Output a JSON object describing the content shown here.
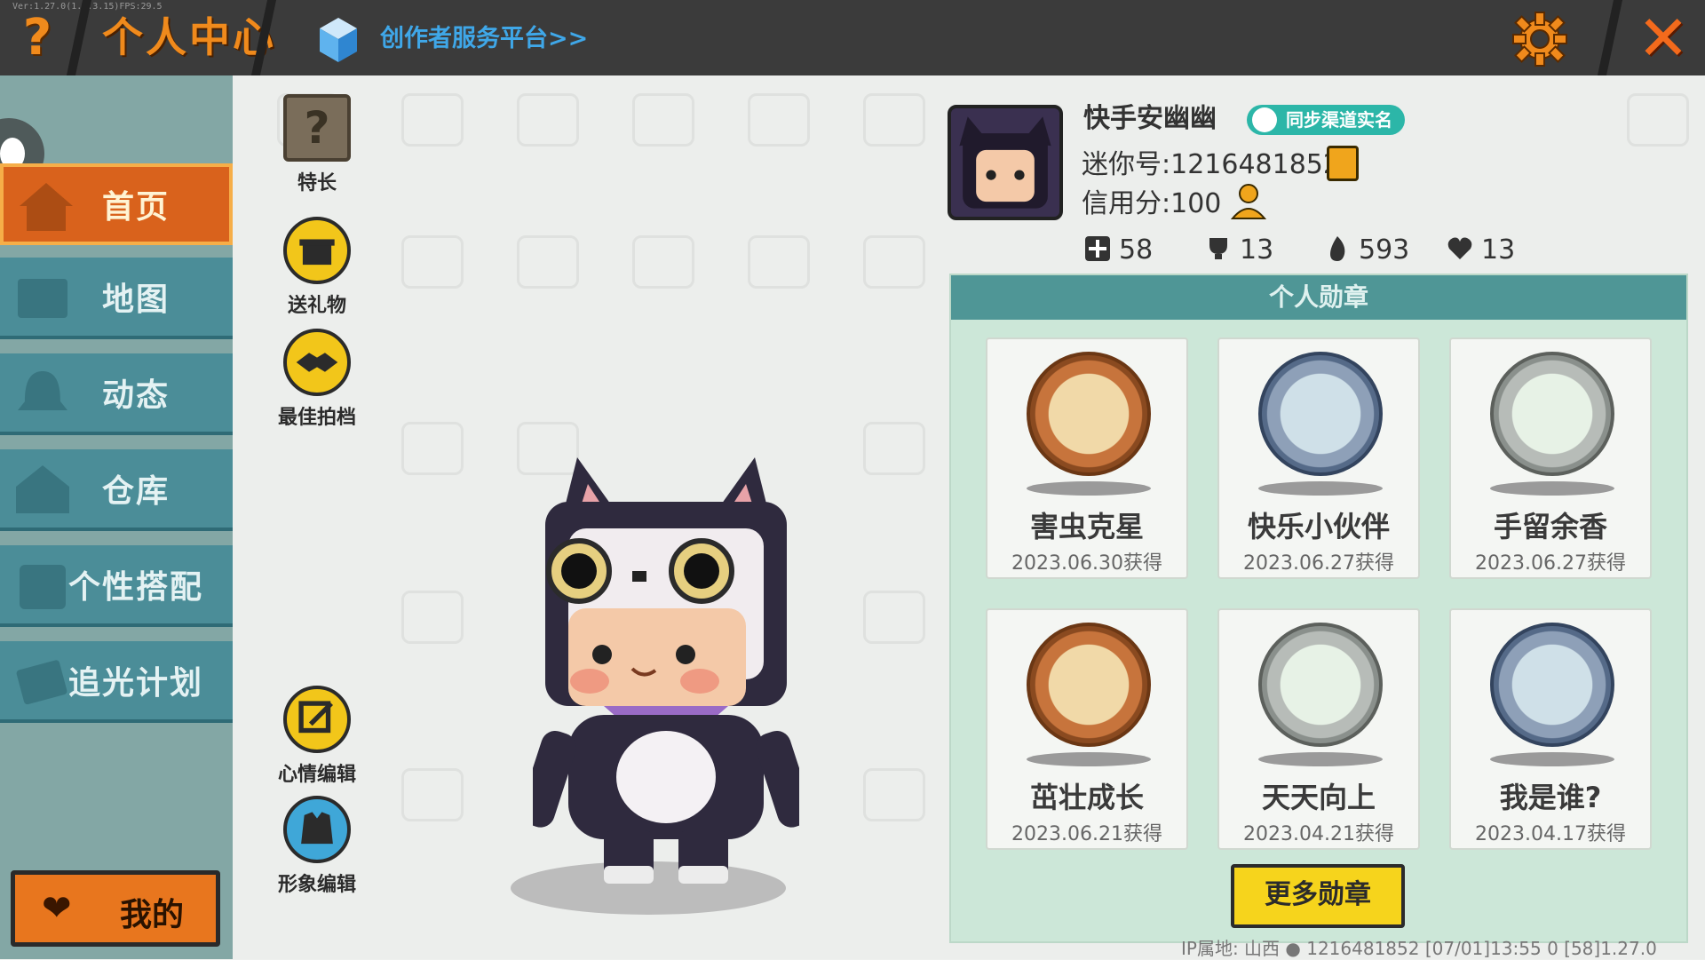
{
  "header": {
    "version_text": "Ver:1.27.0(1.2.3.15)FPS:29.5",
    "help_icon": "?",
    "title": "个人中心",
    "creator_link": "创作者服务平台>>",
    "close_icon": "✕"
  },
  "sidebar": {
    "items": [
      {
        "label": "首页",
        "icon": "home-icon",
        "active": true
      },
      {
        "label": "地图",
        "icon": "map-icon",
        "active": false
      },
      {
        "label": "动态",
        "icon": "bell-icon",
        "active": false
      },
      {
        "label": "仓库",
        "icon": "house-icon",
        "active": false
      },
      {
        "label": "个性搭配",
        "icon": "wardrobe-icon",
        "active": false
      },
      {
        "label": "追光计划",
        "icon": "spotlight-icon",
        "active": false
      }
    ],
    "my_button": "我的"
  },
  "actions": {
    "specialty": "特长",
    "send_gift": "送礼物",
    "best_partner": "最佳拍档",
    "mood_edit": "心情编辑",
    "avatar_edit": "形象编辑"
  },
  "profile": {
    "username": "快手安幽幽",
    "realname_badge": "同步渠道实名",
    "mini_id": "迷你号:1216481852",
    "credit": "信用分:100",
    "stats": [
      {
        "icon": "plus-icon",
        "value": "58"
      },
      {
        "icon": "trophy-icon",
        "value": "13"
      },
      {
        "icon": "flame-icon",
        "value": "593"
      },
      {
        "icon": "heart-icon",
        "value": "13"
      }
    ]
  },
  "medals": {
    "header": "个人勋章",
    "items": [
      {
        "name": "害虫克星",
        "date": "2023.06.30获得",
        "style": "bronze"
      },
      {
        "name": "快乐小伙伴",
        "date": "2023.06.27获得",
        "style": "silver"
      },
      {
        "name": "手留余香",
        "date": "2023.06.27获得",
        "style": "grey"
      },
      {
        "name": "茁壮成长",
        "date": "2023.06.21获得",
        "style": "bronze"
      },
      {
        "name": "天天向上",
        "date": "2023.04.21获得",
        "style": "grey"
      },
      {
        "name": "我是谁?",
        "date": "2023.04.17获得",
        "style": "silver"
      }
    ],
    "more_button": "更多勋章"
  },
  "footer": {
    "ip_label": "IP属地: 山西",
    "info": "1216481852   [07/01]13:55 0  [58]1.27.0"
  },
  "colors": {
    "accent_orange": "#f08a1c",
    "sidebar_teal": "#4b8d98",
    "medal_header": "#4f9696",
    "button_yellow": "#f6d41c"
  }
}
